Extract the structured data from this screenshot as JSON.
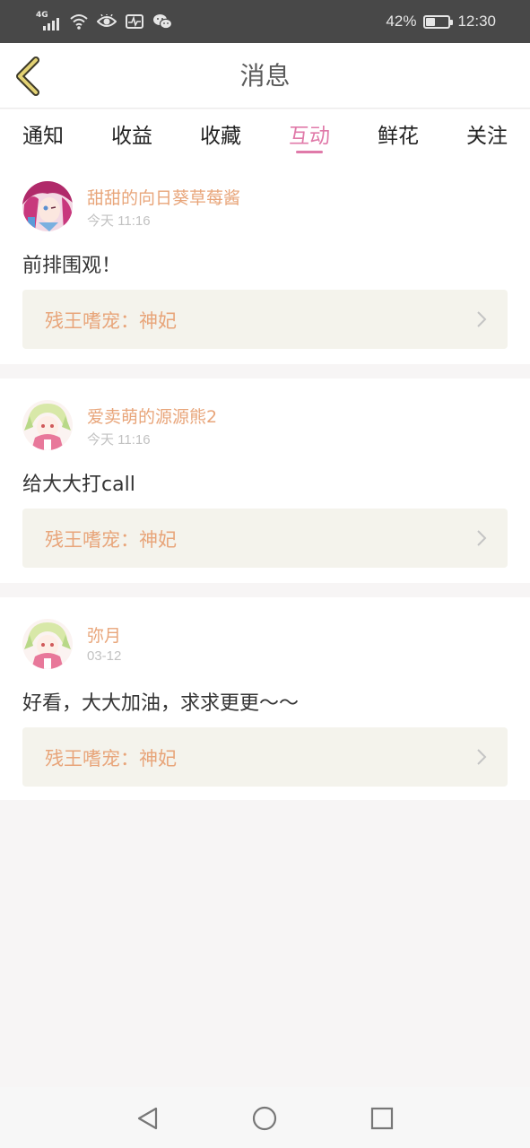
{
  "status": {
    "network": "4G",
    "battery_text": "42%",
    "battery_level": 0.42,
    "time": "12:30",
    "icons": [
      "signal-icon",
      "wifi-icon",
      "eye-icon",
      "activity-icon",
      "wechat-icon"
    ]
  },
  "header": {
    "title": "消息",
    "back_icon": "chevron-left-icon"
  },
  "tabs": [
    {
      "label": "通知",
      "active": false
    },
    {
      "label": "收益",
      "active": false
    },
    {
      "label": "收藏",
      "active": false
    },
    {
      "label": "互动",
      "active": true
    },
    {
      "label": "鲜花",
      "active": false
    },
    {
      "label": "关注",
      "active": false
    }
  ],
  "colors": {
    "accent": "#e07aa9",
    "username": "#e8a57a",
    "link_bg": "#f4f3ec"
  },
  "messages": [
    {
      "username": "甜甜的向日葵草莓酱",
      "time": "今天 11:16",
      "comment": "前排围观！",
      "book": "残王嗜宠：神妃"
    },
    {
      "username": "爱卖萌的源源熊2",
      "time": "今天 11:16",
      "comment": "给大大打call",
      "book": "残王嗜宠：神妃"
    },
    {
      "username": "弥月",
      "time": "03-12",
      "comment": "好看，大大加油，求求更更～～",
      "book": "残王嗜宠：神妃"
    }
  ],
  "navbar": {
    "icons": [
      "back-triangle-icon",
      "home-circle-icon",
      "recents-square-icon"
    ]
  }
}
